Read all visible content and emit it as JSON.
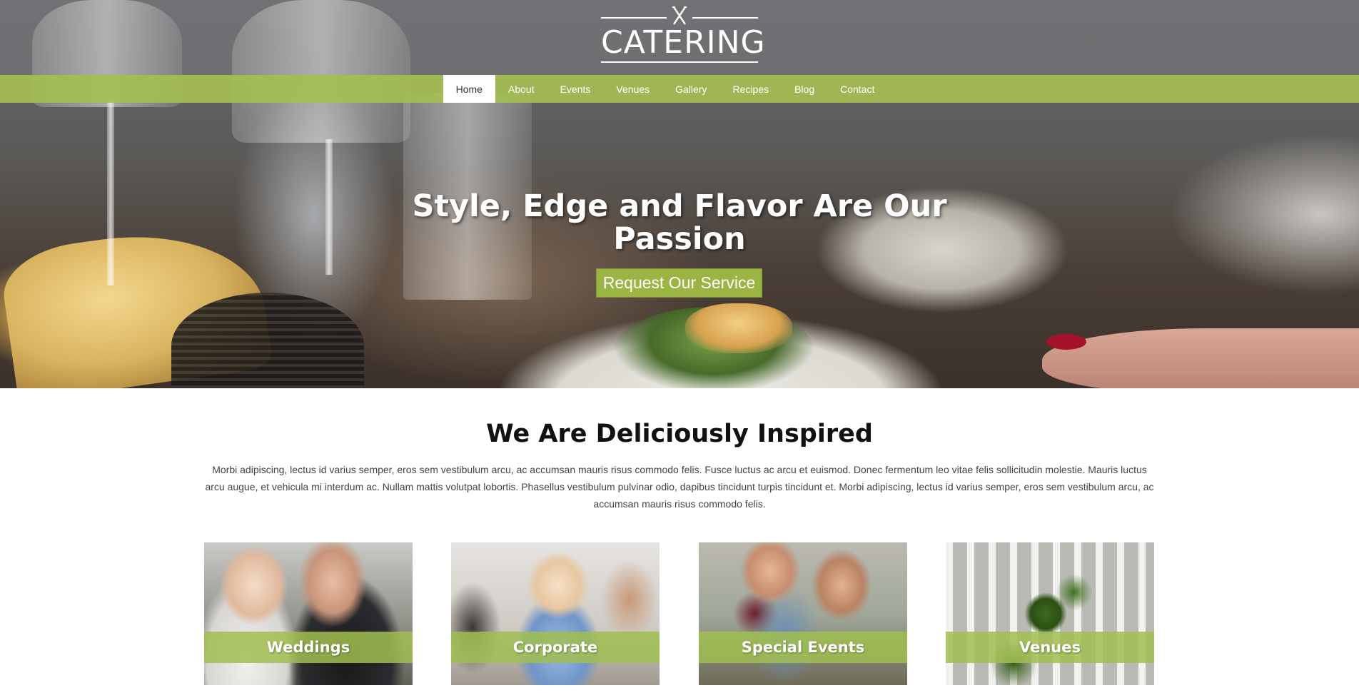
{
  "brand": {
    "name": "CATERING",
    "icon": "fork-knife-icon"
  },
  "nav": {
    "items": [
      {
        "label": "Home",
        "active": true
      },
      {
        "label": "About"
      },
      {
        "label": "Events"
      },
      {
        "label": "Venues"
      },
      {
        "label": "Gallery"
      },
      {
        "label": "Recipes"
      },
      {
        "label": "Blog"
      },
      {
        "label": "Contact"
      }
    ]
  },
  "hero": {
    "title": "Style, Edge and Flavor Are Our Passion",
    "cta_label": "Request Our Service"
  },
  "intro": {
    "title": "We Are Deliciously Inspired",
    "text": "Morbi adipiscing, lectus id varius semper, eros sem vestibulum arcu, ac accumsan mauris risus commodo felis. Fusce luctus ac arcu et euismod. Donec fermentum leo vitae felis sollicitudin molestie. Mauris luctus arcu augue, et vehicula mi interdum ac. Nullam mattis volutpat lobortis. Phasellus vestibulum pulvinar odio, dapibus tincidunt turpis tincidunt et. Morbi adipiscing, lectus id varius semper, eros sem vestibulum arcu, ac accumsan mauris risus commodo felis."
  },
  "cards": [
    {
      "label": "Weddings"
    },
    {
      "label": "Corporate"
    },
    {
      "label": "Special Events"
    },
    {
      "label": "Venues"
    }
  ],
  "colors": {
    "accent": "#a5be55",
    "button": "#9bb545",
    "nav_active_bg": "#ffffff"
  }
}
